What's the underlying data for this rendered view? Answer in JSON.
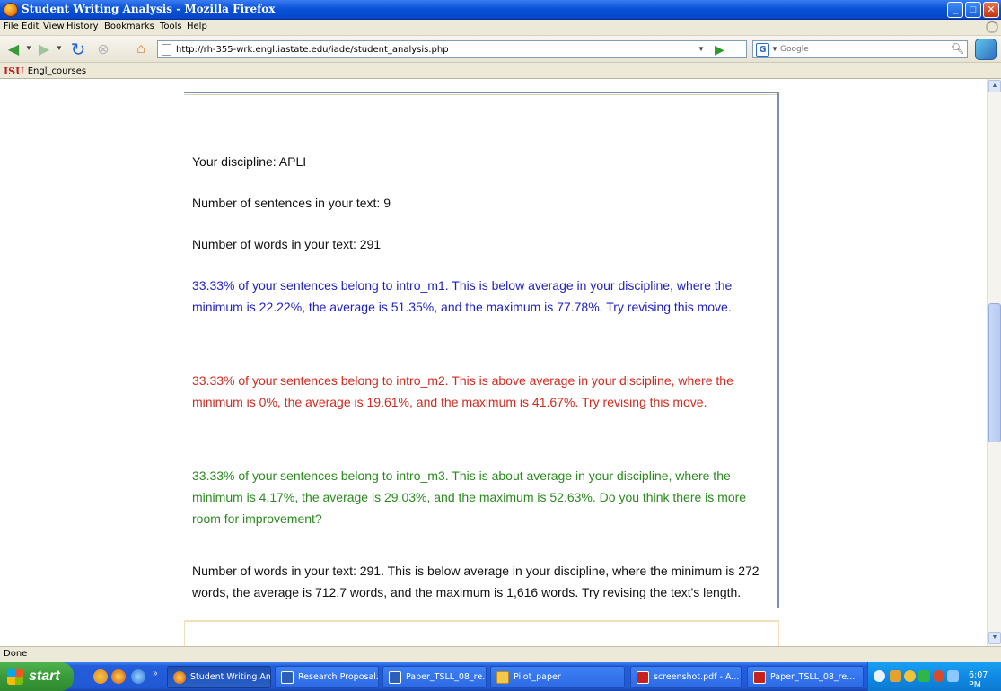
{
  "window": {
    "title": "Student Writing Analysis - Mozilla Firefox"
  },
  "menu": [
    "File",
    "Edit",
    "View",
    "History",
    "Bookmarks",
    "Tools",
    "Help"
  ],
  "navigation": {
    "url": "http://rh-355-wrk.engl.iastate.edu/iade/student_analysis.php",
    "search_engine_label": "G",
    "search_placeholder": "Google"
  },
  "bookmarks": {
    "logo_text": "ISU",
    "item": "Engl_courses"
  },
  "content": {
    "paragraphs": [
      {
        "text": "Your discipline: APLI",
        "color": "#111111"
      },
      {
        "text": "Number of sentences in your text: 9",
        "color": "#111111"
      },
      {
        "text": "Number of words in your text: 291",
        "color": "#111111"
      },
      {
        "text": "33.33% of your sentences belong to intro_m1. This is below average in your discipline, where the minimum is 22.22%, the average is 51.35%, and the maximum is 77.78%. Try revising this move.",
        "color": "#1f1fc8"
      },
      {
        "text": "33.33% of your sentences belong to intro_m2. This is above average in your discipline, where the minimum is 0%, the average is 19.61%, and the maximum is 41.67%. Try revising this move.",
        "color": "#d22a20"
      },
      {
        "text": "33.33% of your sentences belong to intro_m3. This is about average in your discipline, where the minimum is 4.17%, the average is 29.03%, and the maximum is 52.63%. Do you think there is more room for improvement?",
        "color": "#2a8a1e"
      },
      {
        "text": "Number of words in your text: 291. This is below average in your discipline, where the minimum is 272 words, the average is 712.7 words, and the maximum is 1,616 words. Try revising the text's length.",
        "color": "#111111"
      }
    ]
  },
  "status": {
    "text": "Done"
  },
  "taskbar": {
    "start_label": "start",
    "items": [
      {
        "label": "Student Writing An...",
        "active": true,
        "icon": "firefox-icon"
      },
      {
        "label": "Research Proposal...",
        "active": false,
        "icon": "document-icon"
      },
      {
        "label": "Paper_TSLL_08_re...",
        "active": false,
        "icon": "document-icon"
      },
      {
        "label": "Pilot_paper",
        "active": false,
        "icon": "folder-icon"
      },
      {
        "label": "screenshot.pdf - A...",
        "active": false,
        "icon": "pdf-icon"
      },
      {
        "label": "Paper_TSLL_08_re...",
        "active": false,
        "icon": "pdf-icon"
      }
    ],
    "clock": "6:07 PM"
  }
}
